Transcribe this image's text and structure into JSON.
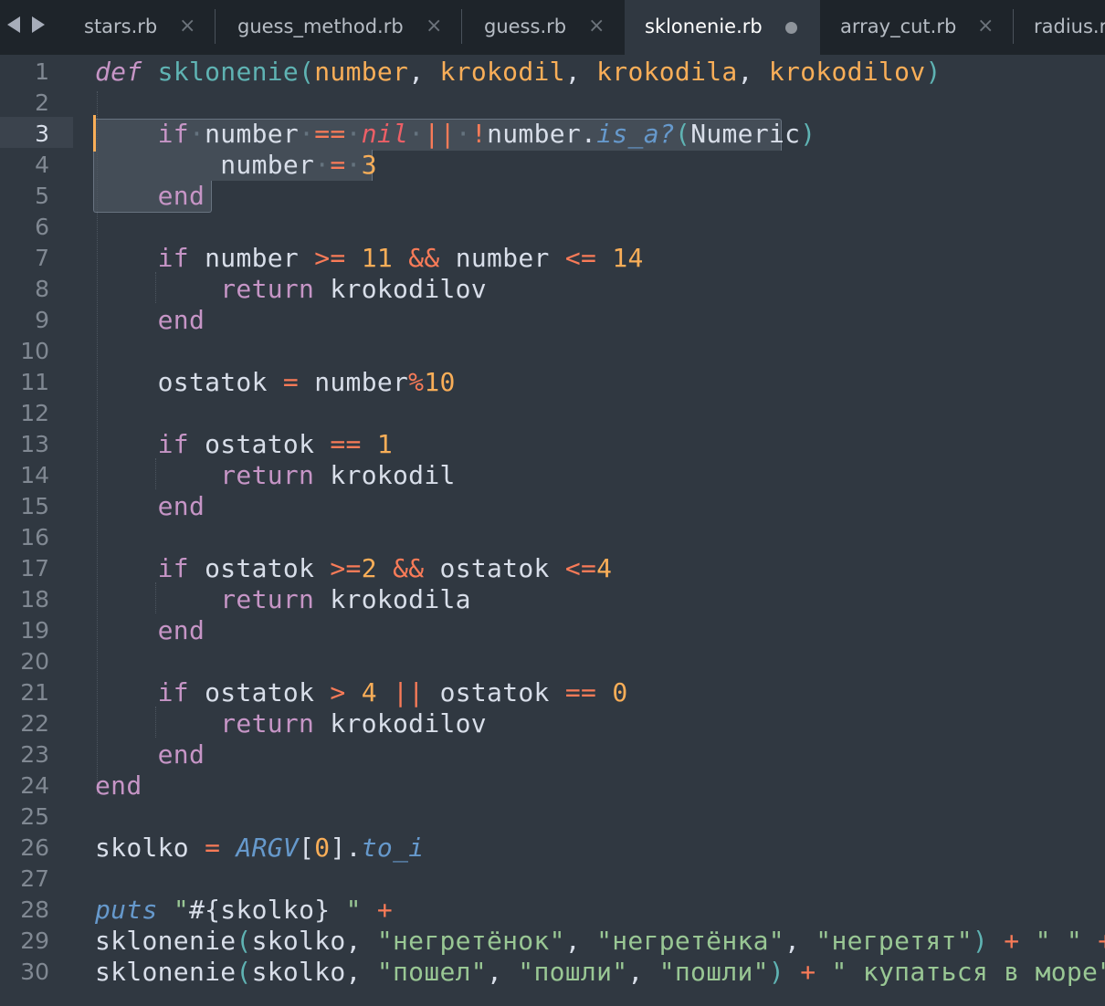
{
  "tabs": [
    {
      "label": "stars.rb",
      "close_icon": "×"
    },
    {
      "label": "guess_method.rb",
      "close_icon": "×"
    },
    {
      "label": "guess.rb",
      "close_icon": "×"
    },
    {
      "label": "sklonenie.rb",
      "modified": true
    },
    {
      "label": "array_cut.rb",
      "close_icon": "×"
    },
    {
      "label": "radius.r"
    }
  ],
  "active_tab": "sklonenie.rb",
  "current_line": 3,
  "line_numbers": [
    "1",
    "2",
    "3",
    "4",
    "5",
    "6",
    "7",
    "8",
    "9",
    "10",
    "11",
    "12",
    "13",
    "14",
    "15",
    "16",
    "17",
    "18",
    "19",
    "20",
    "21",
    "22",
    "23",
    "24",
    "25",
    "26",
    "27",
    "28",
    "29",
    "30"
  ],
  "colors": {
    "background": "#303841",
    "tabbar": "#1e242a",
    "keyword": "#c695c6",
    "function": "#5fb3b3",
    "param": "#f9ae58",
    "operator": "#f97b58",
    "string": "#99c794",
    "nil": "#ec5f66",
    "method": "#6699cc"
  },
  "code": {
    "l1": [
      {
        "t": "def",
        "c": "kwi"
      },
      {
        "t": " ",
        "c": "pl"
      },
      {
        "t": "sklonenie",
        "c": "fn"
      },
      {
        "t": "(",
        "c": "punc"
      },
      {
        "t": "number",
        "c": "param"
      },
      {
        "t": ", ",
        "c": "pl"
      },
      {
        "t": "krokodil",
        "c": "param"
      },
      {
        "t": ", ",
        "c": "pl"
      },
      {
        "t": "krokodila",
        "c": "param"
      },
      {
        "t": ", ",
        "c": "pl"
      },
      {
        "t": "krokodilov",
        "c": "param"
      },
      {
        "t": ")",
        "c": "punc"
      }
    ],
    "l3": [
      {
        "t": "    ",
        "c": "pl"
      },
      {
        "t": "if",
        "c": "kw"
      },
      {
        "t": "·",
        "c": "ws"
      },
      {
        "t": "number",
        "c": "var"
      },
      {
        "t": "·",
        "c": "ws"
      },
      {
        "t": "==",
        "c": "op"
      },
      {
        "t": "·",
        "c": "ws"
      },
      {
        "t": "nil",
        "c": "nil"
      },
      {
        "t": "·",
        "c": "ws"
      },
      {
        "t": "||",
        "c": "op"
      },
      {
        "t": "·",
        "c": "ws"
      },
      {
        "t": "!",
        "c": "op"
      },
      {
        "t": "number",
        "c": "var"
      },
      {
        "t": ".",
        "c": "pl"
      },
      {
        "t": "is_a?",
        "c": "meth"
      },
      {
        "t": "(",
        "c": "punc"
      },
      {
        "t": "Numeric",
        "c": "var"
      },
      {
        "t": ")",
        "c": "punc"
      }
    ],
    "l4": [
      {
        "t": "        ",
        "c": "pl"
      },
      {
        "t": "number",
        "c": "var"
      },
      {
        "t": "·",
        "c": "ws"
      },
      {
        "t": "=",
        "c": "op"
      },
      {
        "t": "·",
        "c": "ws"
      },
      {
        "t": "3",
        "c": "num"
      }
    ],
    "l5": [
      {
        "t": "    ",
        "c": "pl"
      },
      {
        "t": "end",
        "c": "kw"
      }
    ],
    "l7": [
      {
        "t": "    ",
        "c": "pl"
      },
      {
        "t": "if",
        "c": "kw"
      },
      {
        "t": " number ",
        "c": "var"
      },
      {
        "t": ">=",
        "c": "op"
      },
      {
        "t": " ",
        "c": "pl"
      },
      {
        "t": "11",
        "c": "num"
      },
      {
        "t": " ",
        "c": "pl"
      },
      {
        "t": "&&",
        "c": "op"
      },
      {
        "t": " number ",
        "c": "var"
      },
      {
        "t": "<=",
        "c": "op"
      },
      {
        "t": " ",
        "c": "pl"
      },
      {
        "t": "14",
        "c": "num"
      }
    ],
    "l8": [
      {
        "t": "        ",
        "c": "pl"
      },
      {
        "t": "return",
        "c": "kw"
      },
      {
        "t": " krokodilov",
        "c": "var"
      }
    ],
    "l9": [
      {
        "t": "    ",
        "c": "pl"
      },
      {
        "t": "end",
        "c": "kw"
      }
    ],
    "l11": [
      {
        "t": "    ostatok ",
        "c": "var"
      },
      {
        "t": "=",
        "c": "op"
      },
      {
        "t": " number",
        "c": "var"
      },
      {
        "t": "%",
        "c": "op"
      },
      {
        "t": "10",
        "c": "num"
      }
    ],
    "l13": [
      {
        "t": "    ",
        "c": "pl"
      },
      {
        "t": "if",
        "c": "kw"
      },
      {
        "t": " ostatok ",
        "c": "var"
      },
      {
        "t": "==",
        "c": "op"
      },
      {
        "t": " ",
        "c": "pl"
      },
      {
        "t": "1",
        "c": "num"
      }
    ],
    "l14": [
      {
        "t": "        ",
        "c": "pl"
      },
      {
        "t": "return",
        "c": "kw"
      },
      {
        "t": " krokodil",
        "c": "var"
      }
    ],
    "l15": [
      {
        "t": "    ",
        "c": "pl"
      },
      {
        "t": "end",
        "c": "kw"
      }
    ],
    "l17": [
      {
        "t": "    ",
        "c": "pl"
      },
      {
        "t": "if",
        "c": "kw"
      },
      {
        "t": " ostatok ",
        "c": "var"
      },
      {
        "t": ">=",
        "c": "op"
      },
      {
        "t": "2",
        "c": "num"
      },
      {
        "t": " ",
        "c": "pl"
      },
      {
        "t": "&&",
        "c": "op"
      },
      {
        "t": " ostatok ",
        "c": "var"
      },
      {
        "t": "<=",
        "c": "op"
      },
      {
        "t": "4",
        "c": "num"
      }
    ],
    "l18": [
      {
        "t": "        ",
        "c": "pl"
      },
      {
        "t": "return",
        "c": "kw"
      },
      {
        "t": " krokodila",
        "c": "var"
      }
    ],
    "l19": [
      {
        "t": "    ",
        "c": "pl"
      },
      {
        "t": "end",
        "c": "kw"
      }
    ],
    "l21": [
      {
        "t": "    ",
        "c": "pl"
      },
      {
        "t": "if",
        "c": "kw"
      },
      {
        "t": " ostatok ",
        "c": "var"
      },
      {
        "t": ">",
        "c": "op"
      },
      {
        "t": " ",
        "c": "pl"
      },
      {
        "t": "4",
        "c": "num"
      },
      {
        "t": " ",
        "c": "pl"
      },
      {
        "t": "||",
        "c": "op"
      },
      {
        "t": " ostatok ",
        "c": "var"
      },
      {
        "t": "==",
        "c": "op"
      },
      {
        "t": " ",
        "c": "pl"
      },
      {
        "t": "0",
        "c": "num"
      }
    ],
    "l22": [
      {
        "t": "        ",
        "c": "pl"
      },
      {
        "t": "return",
        "c": "kw"
      },
      {
        "t": " krokodilov",
        "c": "var"
      }
    ],
    "l23": [
      {
        "t": "    ",
        "c": "pl"
      },
      {
        "t": "end",
        "c": "kw"
      }
    ],
    "l24": [
      {
        "t": "end",
        "c": "kw"
      }
    ],
    "l26": [
      {
        "t": "skolko ",
        "c": "var"
      },
      {
        "t": "=",
        "c": "op"
      },
      {
        "t": " ",
        "c": "pl"
      },
      {
        "t": "ARGV",
        "c": "const"
      },
      {
        "t": "[",
        "c": "pl"
      },
      {
        "t": "0",
        "c": "num"
      },
      {
        "t": "].",
        "c": "pl"
      },
      {
        "t": "to_i",
        "c": "meth"
      }
    ],
    "l28": [
      {
        "t": "puts",
        "c": "meth"
      },
      {
        "t": " ",
        "c": "pl"
      },
      {
        "t": "\"",
        "c": "str"
      },
      {
        "t": "#{skolko}",
        "c": "var"
      },
      {
        "t": " \"",
        "c": "str"
      },
      {
        "t": " ",
        "c": "pl"
      },
      {
        "t": "+",
        "c": "op"
      }
    ],
    "l29": [
      {
        "t": "sklonenie",
        "c": "var"
      },
      {
        "t": "(",
        "c": "punc"
      },
      {
        "t": "skolko, ",
        "c": "var"
      },
      {
        "t": "\"негретёнок\"",
        "c": "str"
      },
      {
        "t": ", ",
        "c": "pl"
      },
      {
        "t": "\"негретёнка\"",
        "c": "str"
      },
      {
        "t": ", ",
        "c": "pl"
      },
      {
        "t": "\"негретят\"",
        "c": "str"
      },
      {
        "t": ")",
        "c": "punc"
      },
      {
        "t": " ",
        "c": "pl"
      },
      {
        "t": "+",
        "c": "op"
      },
      {
        "t": " ",
        "c": "pl"
      },
      {
        "t": "\" \"",
        "c": "str"
      },
      {
        "t": " ",
        "c": "pl"
      },
      {
        "t": "+",
        "c": "op"
      }
    ],
    "l30": [
      {
        "t": "sklonenie",
        "c": "var"
      },
      {
        "t": "(",
        "c": "punc"
      },
      {
        "t": "skolko, ",
        "c": "var"
      },
      {
        "t": "\"пошел\"",
        "c": "str"
      },
      {
        "t": ", ",
        "c": "pl"
      },
      {
        "t": "\"пошли\"",
        "c": "str"
      },
      {
        "t": ", ",
        "c": "pl"
      },
      {
        "t": "\"пошли\"",
        "c": "str"
      },
      {
        "t": ")",
        "c": "punc"
      },
      {
        "t": " ",
        "c": "pl"
      },
      {
        "t": "+",
        "c": "op"
      },
      {
        "t": " ",
        "c": "pl"
      },
      {
        "t": "\" купаться в море\"",
        "c": "str"
      }
    ]
  }
}
